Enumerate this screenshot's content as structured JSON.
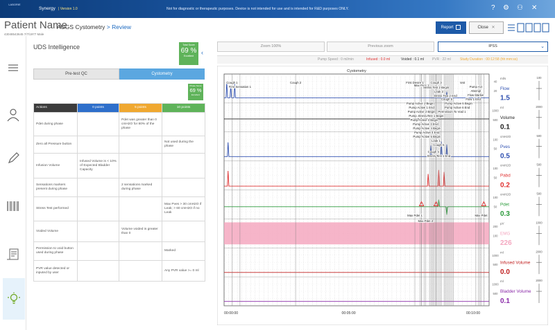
{
  "topbar": {
    "logo_text": "LABORIE",
    "app_name": "Synergy",
    "app_version": "| Version 1.0",
    "disclaimer": "Not for diagnostic or therapeutic purposes. Device is not intended for use and is intended for R&D purposes ONLY."
  },
  "header": {
    "patient_name": "Patient Name",
    "patient_sub": "43048543645  7/7/1977  Male",
    "breadcrumb_main": "AUGS Cystometry",
    "breadcrumb_sep": " > ",
    "breadcrumb_link": "Review",
    "report_label": "Report",
    "close_label": "Close"
  },
  "sidebar": {
    "icons": [
      "menu-icon",
      "person-icon",
      "pencil-icon",
      "barcode-icon",
      "report-icon",
      "lightbulb-icon"
    ]
  },
  "left": {
    "title": "UDS Intelligence",
    "total_score_label": "Total Score",
    "total_score": "69 %",
    "total_score_status": "Excellent",
    "tabs": [
      "Pre-test QC",
      "Cystometry"
    ],
    "phase_score_label": "Phase Score",
    "phase_score": "69 %",
    "phase_score_status": "Excellent",
    "headers": [
      "Actions",
      "0 points",
      "5 points",
      "10 points"
    ],
    "rows": [
      {
        "action": "Pdet during phase",
        "p0": "",
        "p5": "Pdet was greater than 0 cmH2O for 80% of the phase",
        "p10": ""
      },
      {
        "action": "Zero all Pressure button",
        "p0": "",
        "p5": "",
        "p10": "Not used during the phase"
      },
      {
        "action": "Infusion Volume",
        "p0": "Infused Volume is < 10% of Expected Bladder Capacity",
        "p5": "",
        "p10": ""
      },
      {
        "action": "Sensations markers present during phase",
        "p0": "",
        "p5": "2 sensations marked during phase",
        "p10": ""
      },
      {
        "action": "Stress Test performed",
        "p0": "",
        "p5": "",
        "p10": "Max Pves > 30 cmH2O if Leak; > 60 cmH2O if no Leak"
      },
      {
        "action": "Voided Volume",
        "p0": "",
        "p5": "Volume voided is greater than 0",
        "p10": ""
      },
      {
        "action": "Permission to void button used during phase",
        "p0": "",
        "p5": "",
        "p10": "Marked"
      },
      {
        "action": "PVR value detected or inputed by user",
        "p0": "",
        "p5": "",
        "p10": "Any PVR value >= 0 ml"
      }
    ]
  },
  "controls": {
    "zoom_label": "Zoom 100%",
    "prev_zoom_label": "Previous zoom",
    "blank_label": "",
    "protocol": "IPSS"
  },
  "status": {
    "pump_speed": "Pump Speed : 0 ml/min",
    "infused": "Infused : 0.0 ml",
    "voided": "Voided : 0.1 ml",
    "pvr": "PVR : 22 ml",
    "duration": "Study Duration : 00:12:58 (hh:mm:ss)"
  },
  "chart_data": {
    "type": "line",
    "title": "Cystometry",
    "x_ticks": [
      "00:00:00",
      "00:05:00",
      "00:10:00"
    ],
    "channels": [
      {
        "name": "Flow",
        "unit": "ml/s",
        "value": "1.5",
        "color": "#2e4fb0",
        "scale_top": "100",
        "scale_mid": "40",
        "scale_low": "20"
      },
      {
        "name": "Volume",
        "unit": "ml",
        "value": "0.1",
        "color": "#222222",
        "scale_top": "2000",
        "scale_mid": "1000",
        "scale_low": "500"
      },
      {
        "name": "Pves",
        "unit": "cmH2O",
        "value": "0.5",
        "color": "#2e4fb0",
        "scale_top": "500",
        "scale_mid": "100",
        "scale_low": "50"
      },
      {
        "name": "Pabd",
        "unit": "cmH2O",
        "value": "0.2",
        "color": "#e03030",
        "scale_top": "500",
        "scale_mid": "100",
        "scale_low": "50"
      },
      {
        "name": "Pdet",
        "unit": "cmH2O",
        "value": "0.3",
        "color": "#2a9a3a",
        "scale_top": "500",
        "scale_mid": "100",
        "scale_low": "50"
      },
      {
        "name": "EMG",
        "unit": "µV",
        "value": "226",
        "color": "#f4a8c0",
        "scale_top": "1000",
        "scale_mid": "200",
        "scale_low": "100"
      },
      {
        "name": "Infused Volume",
        "unit": "ml",
        "value": "0.0",
        "color": "#c02020",
        "scale_top": "2000",
        "scale_mid": "1000",
        "scale_low": "500"
      },
      {
        "name": "Bladder Volume",
        "unit": "ml",
        "value": "0.1",
        "color": "#8a2aa8",
        "scale_top": "2000",
        "scale_mid": "1000",
        "scale_low": "500"
      }
    ],
    "events": [
      "Cough 1",
      "First Sensation 1",
      "Cough 2",
      "First Desire 1",
      "Max Pres 1",
      "Cough 3",
      "Stress Test 2 Begin",
      "Leak 2",
      "Stress Test 2 End",
      "Cough 5",
      "test",
      "Pump Active 1 Begin",
      "Pump Active 1 End",
      "Pump Active 2 Begin",
      "Pump Active 2 End",
      "Pump Active 3 Begin",
      "Pump Active 3 End",
      "Pump Active 4 Begin",
      "Pump Active 4 End",
      "Pump Active 5 Begin",
      "Pump Active 6 Begin",
      "Pump Active 6 End",
      "Permission To Void 1",
      "Stress Test 1 Begin",
      "Leak 1",
      "Cough 5",
      "Cough 4",
      "Stress Test 1 End",
      "Pump Act",
      "Attempt",
      "Flow Marker",
      "Flow 1 End",
      "Max Pdet 1",
      "Max Pdet 2",
      "Max Pdet"
    ]
  }
}
